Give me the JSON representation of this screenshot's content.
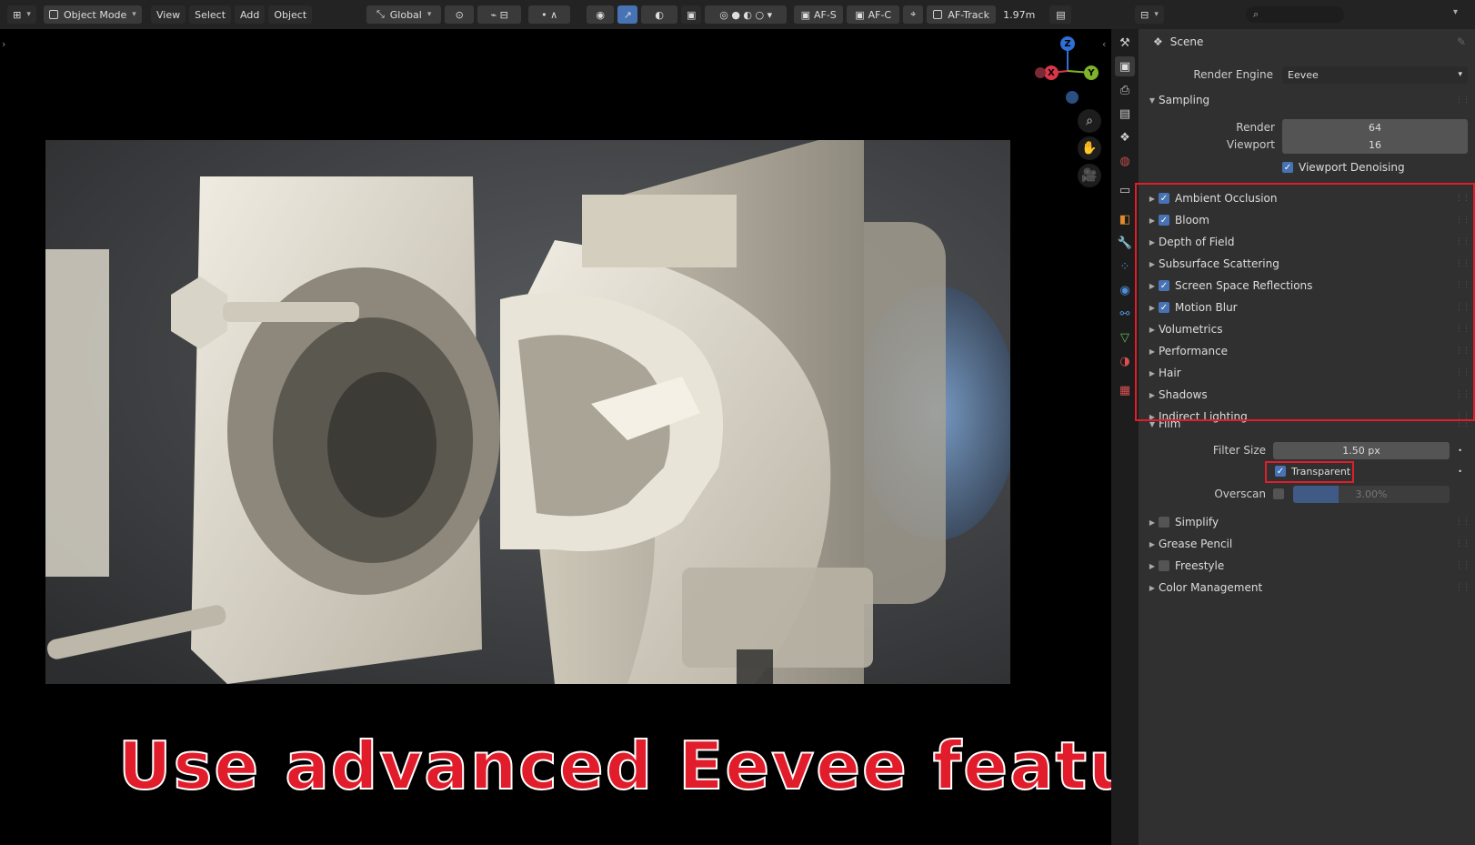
{
  "header": {
    "mode_label": "Object Mode",
    "menus": [
      "View",
      "Select",
      "Add",
      "Object"
    ],
    "orientation_label": "Global",
    "af_s": "AF-S",
    "af_c": "AF-C",
    "af_track": "AF-Track",
    "distance": "1.97m"
  },
  "gizmo": {
    "z": "Z",
    "x": "X",
    "y": "Y"
  },
  "headline": "Use advanced Eevee features",
  "properties": {
    "scene_label": "Scene",
    "render_engine_label": "Render Engine",
    "render_engine_value": "Eevee",
    "sampling": {
      "title": "Sampling",
      "render_label": "Render",
      "render_value": "64",
      "viewport_label": "Viewport",
      "viewport_value": "16",
      "denoise_label": "Viewport Denoising"
    },
    "effects": [
      {
        "label": "Ambient Occlusion",
        "checkbox": true
      },
      {
        "label": "Bloom",
        "checkbox": true
      },
      {
        "label": "Depth of Field",
        "checkbox": null
      },
      {
        "label": "Subsurface Scattering",
        "checkbox": null
      },
      {
        "label": "Screen Space Reflections",
        "checkbox": true
      },
      {
        "label": "Motion Blur",
        "checkbox": true
      },
      {
        "label": "Volumetrics",
        "checkbox": null
      },
      {
        "label": "Performance",
        "checkbox": null
      },
      {
        "label": "Hair",
        "checkbox": null
      },
      {
        "label": "Shadows",
        "checkbox": null
      },
      {
        "label": "Indirect Lighting",
        "checkbox": null
      }
    ],
    "film": {
      "title": "Film",
      "filter_size_label": "Filter Size",
      "filter_size_value": "1.50 px",
      "transparent_label": "Transparent",
      "overscan_label": "Overscan",
      "overscan_value": "3.00%"
    },
    "extras": [
      {
        "label": "Simplify",
        "checkbox": false
      },
      {
        "label": "Grease Pencil",
        "checkbox": null
      },
      {
        "label": "Freestyle",
        "checkbox": false
      },
      {
        "label": "Color Management",
        "checkbox": null
      }
    ]
  },
  "colors": {
    "accent": "#4772b3",
    "highlight": "#e21d2b"
  }
}
